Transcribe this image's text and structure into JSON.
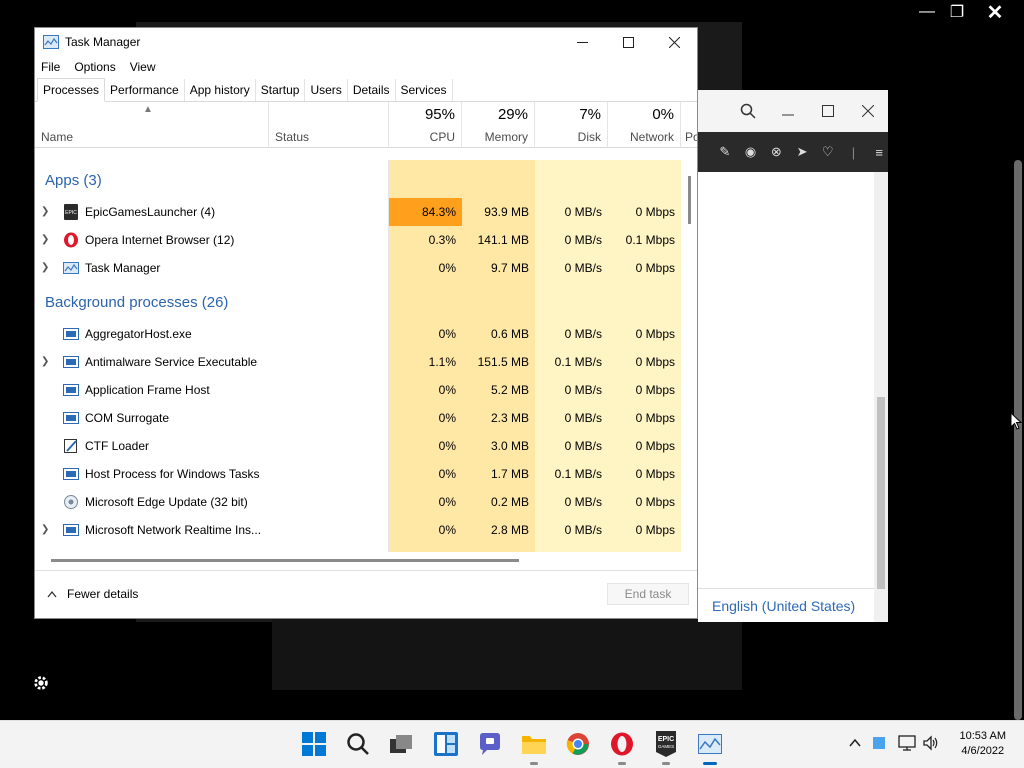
{
  "window": {
    "title": "Task Manager"
  },
  "menu": [
    "File",
    "Options",
    "View"
  ],
  "tabs": [
    "Processes",
    "Performance",
    "App history",
    "Startup",
    "Users",
    "Details",
    "Services"
  ],
  "columns": {
    "name": "Name",
    "status": "Status",
    "cpu": {
      "pct": "95%",
      "label": "CPU"
    },
    "memory": {
      "pct": "29%",
      "label": "Memory"
    },
    "disk": {
      "pct": "7%",
      "label": "Disk"
    },
    "network": {
      "pct": "0%",
      "label": "Network"
    },
    "power": "Po"
  },
  "groups": {
    "apps": "Apps (3)",
    "background": "Background processes (26)"
  },
  "apps": [
    {
      "name": "EpicGamesLauncher (4)",
      "cpu": "84.3%",
      "memory": "93.9 MB",
      "disk": "0 MB/s",
      "network": "0 Mbps",
      "icon": "epic-icon",
      "expandable": true
    },
    {
      "name": "Opera Internet Browser (12)",
      "cpu": "0.3%",
      "memory": "141.1 MB",
      "disk": "0 MB/s",
      "network": "0.1 Mbps",
      "icon": "opera-icon",
      "expandable": true
    },
    {
      "name": "Task Manager",
      "cpu": "0%",
      "memory": "9.7 MB",
      "disk": "0 MB/s",
      "network": "0 Mbps",
      "icon": "task-manager-icon",
      "expandable": true
    }
  ],
  "background": [
    {
      "name": "AggregatorHost.exe",
      "cpu": "0%",
      "memory": "0.6 MB",
      "disk": "0 MB/s",
      "network": "0 Mbps",
      "expandable": false
    },
    {
      "name": "Antimalware Service Executable",
      "cpu": "1.1%",
      "memory": "151.5 MB",
      "disk": "0.1 MB/s",
      "network": "0 Mbps",
      "expandable": true
    },
    {
      "name": "Application Frame Host",
      "cpu": "0%",
      "memory": "5.2 MB",
      "disk": "0 MB/s",
      "network": "0 Mbps",
      "expandable": false
    },
    {
      "name": "COM Surrogate",
      "cpu": "0%",
      "memory": "2.3 MB",
      "disk": "0 MB/s",
      "network": "0 Mbps",
      "expandable": false
    },
    {
      "name": "CTF Loader",
      "cpu": "0%",
      "memory": "3.0 MB",
      "disk": "0 MB/s",
      "network": "0 Mbps",
      "expandable": false
    },
    {
      "name": "Host Process for Windows Tasks",
      "cpu": "0%",
      "memory": "1.7 MB",
      "disk": "0.1 MB/s",
      "network": "0 Mbps",
      "expandable": false
    },
    {
      "name": "Microsoft Edge Update (32 bit)",
      "cpu": "0%",
      "memory": "0.2 MB",
      "disk": "0 MB/s",
      "network": "0 Mbps",
      "expandable": false
    },
    {
      "name": "Microsoft Network Realtime Ins...",
      "cpu": "0%",
      "memory": "2.8 MB",
      "disk": "0 MB/s",
      "network": "0 Mbps",
      "expandable": true
    }
  ],
  "footer": {
    "fewer_details": "Fewer details",
    "end_task": "End task"
  },
  "browser": {
    "language": "English (United States)"
  },
  "clock": {
    "time": "10:53 AM",
    "date": "4/6/2022"
  },
  "colors": {
    "accent": "#0067c0",
    "cpu_high": "#ffa01c",
    "heat_light": "#fff4c4",
    "heat_mid": "#ffe8a6",
    "link_blue": "#2b63ad"
  }
}
